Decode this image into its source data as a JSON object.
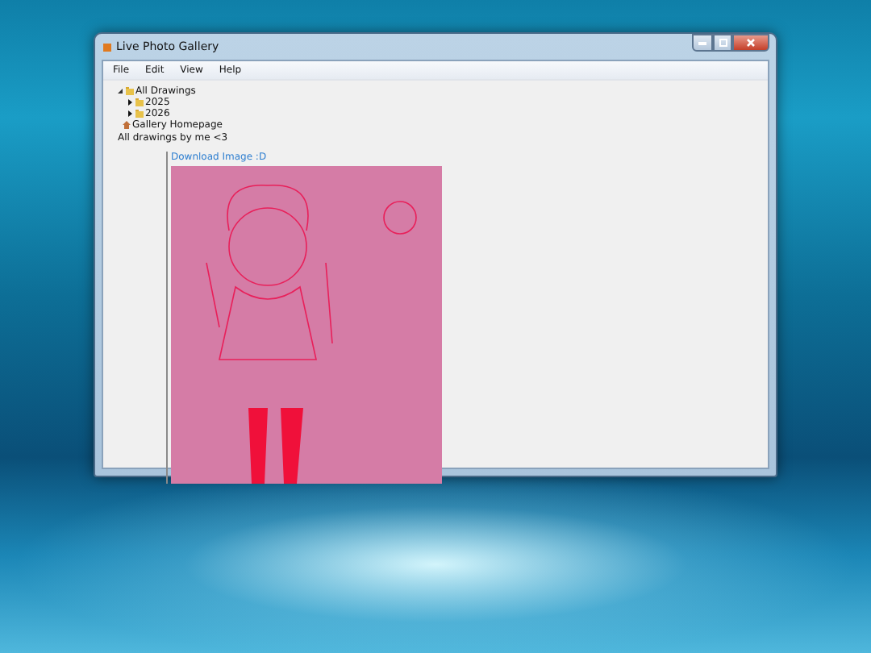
{
  "window": {
    "title": "Live Photo Gallery"
  },
  "menu": [
    "File",
    "Edit",
    "View",
    "Help"
  ],
  "tree": [
    {
      "label": "All Drawings",
      "expanded": true,
      "children": [
        {
          "label": "2025",
          "expanded": false
        },
        {
          "label": "2026",
          "expanded": false
        }
      ]
    }
  ],
  "homepage_link": "Gallery Homepage",
  "caption": "All drawings by me <3",
  "download_link": "Download Image :D"
}
